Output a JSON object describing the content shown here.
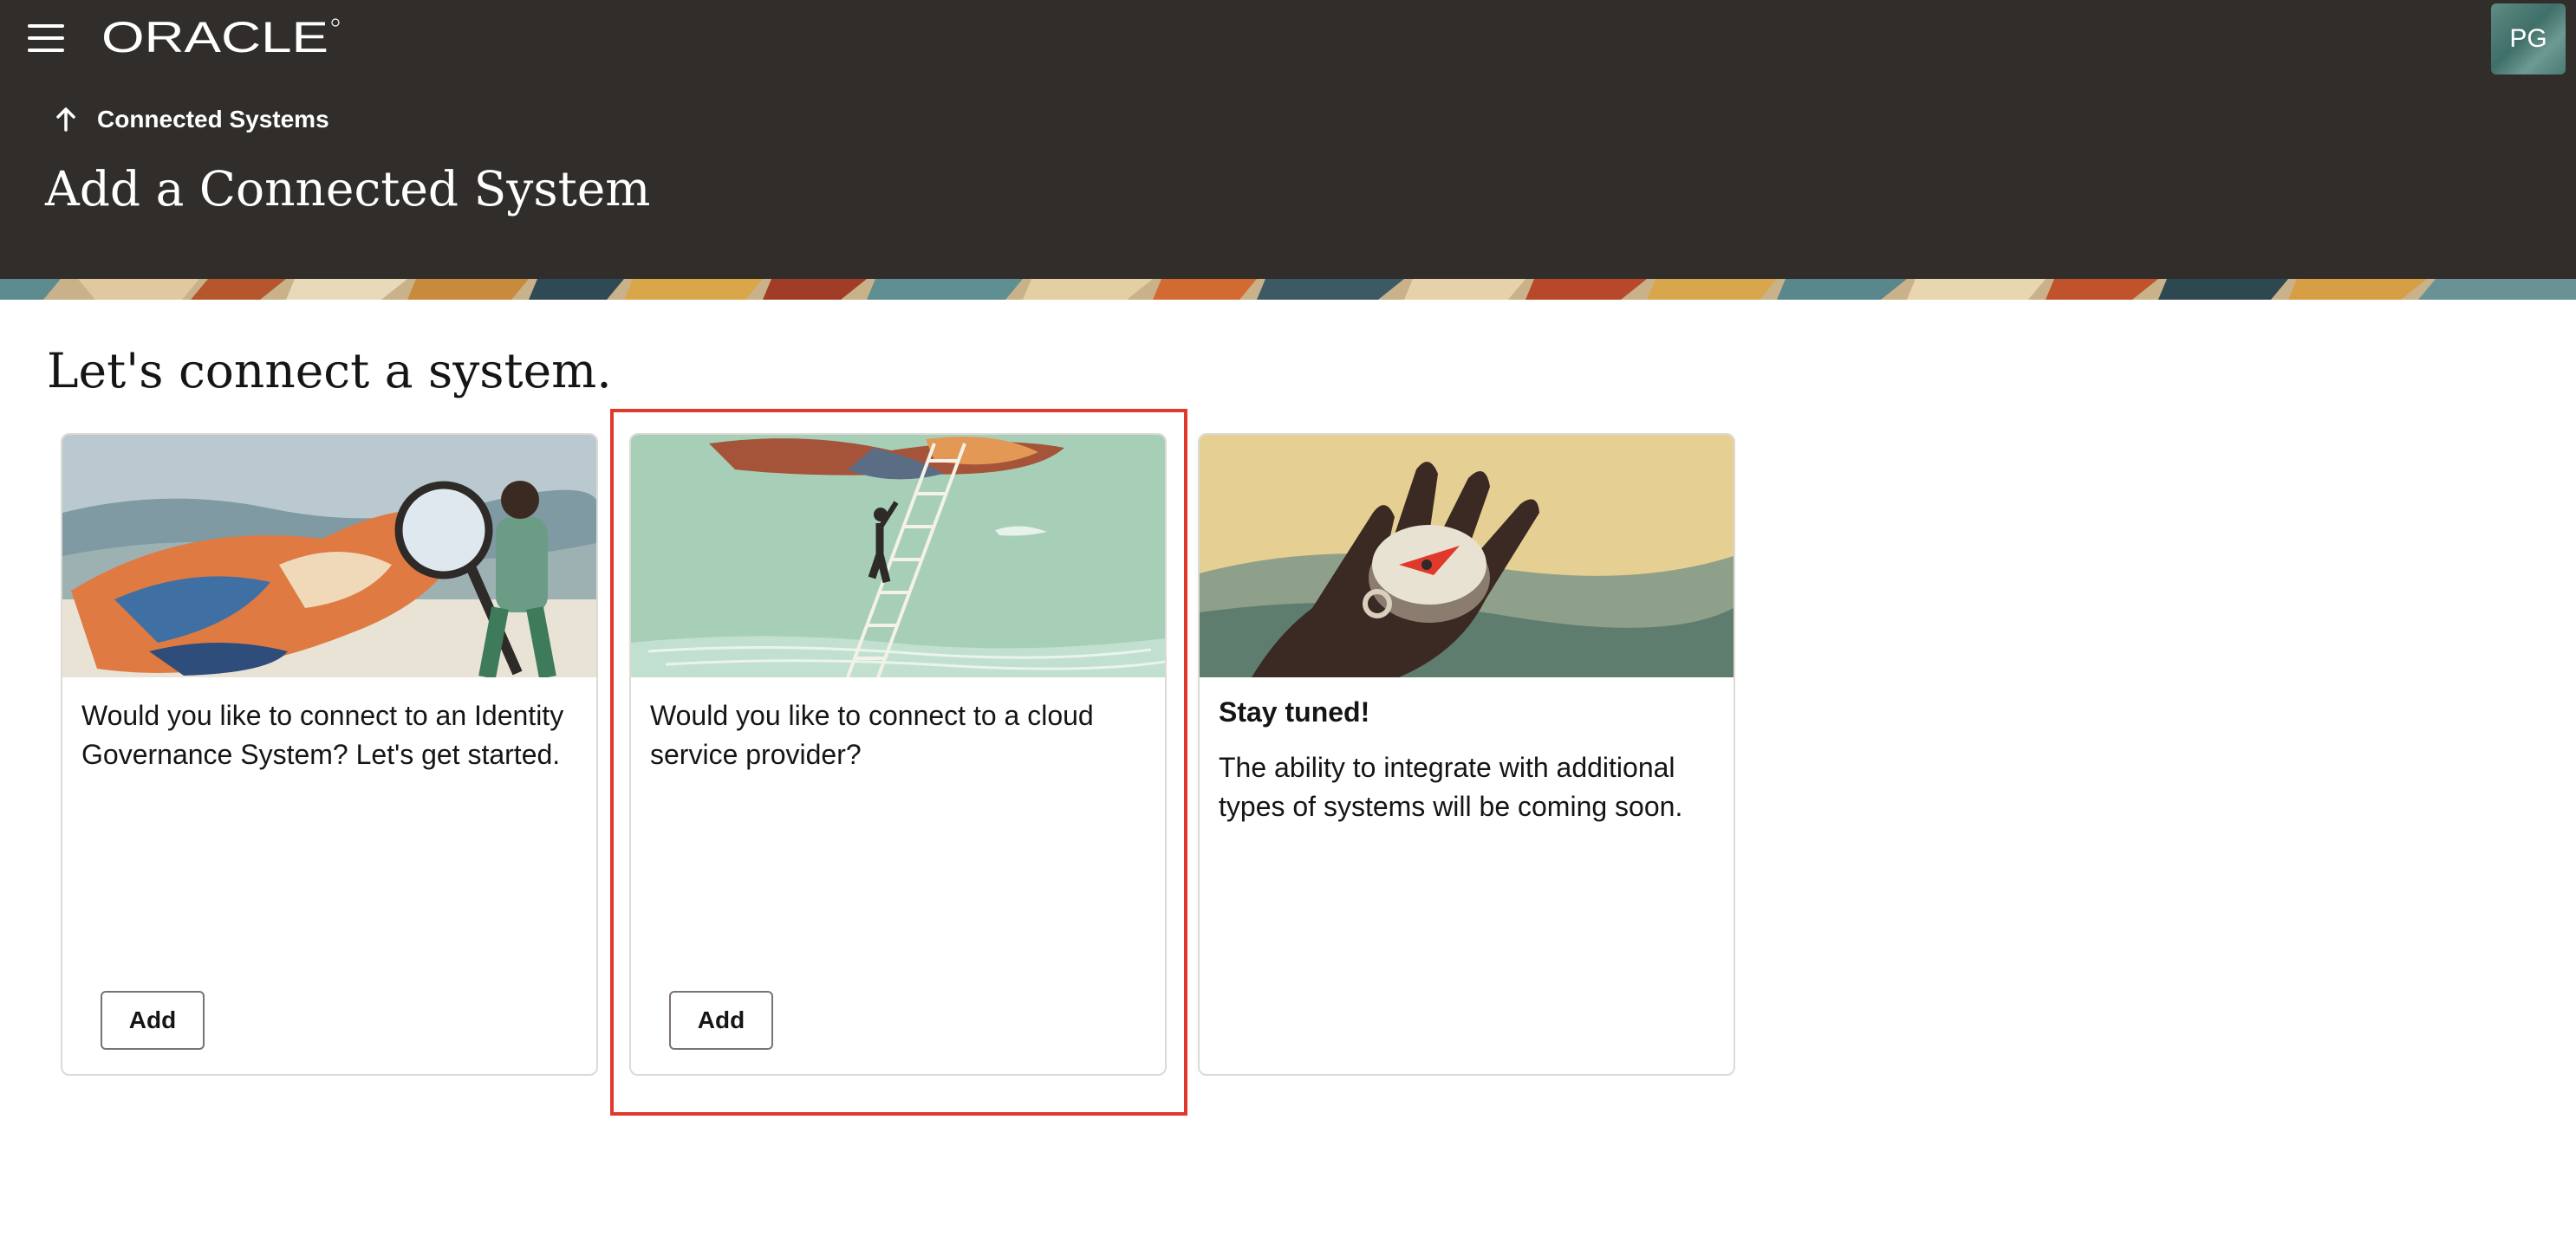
{
  "header": {
    "logo_text": "ORACLE",
    "avatar_initials": "PG",
    "breadcrumb": "Connected Systems",
    "page_title": "Add a Connected System",
    "brand_color": "#312d2a"
  },
  "main": {
    "section_title": "Let's connect a system.",
    "cards": [
      {
        "text": "Would you like to connect to an Identity Governance System? Let's get started.",
        "button": "Add"
      },
      {
        "text": "Would you like to connect to a cloud service provider?",
        "button": "Add"
      },
      {
        "title": "Stay tuned!",
        "text": "The ability to integrate with additional types of systems will be coming soon."
      }
    ]
  },
  "icons": [
    "menu-icon",
    "arrow-up-icon"
  ],
  "highlight_color": "#e0392b"
}
